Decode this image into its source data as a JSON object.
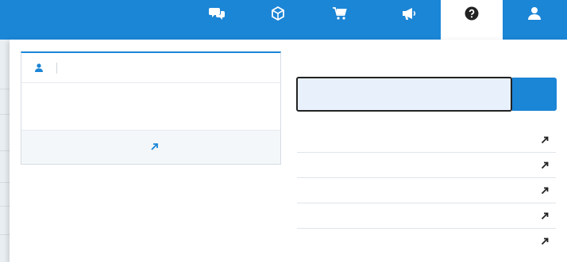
{
  "header": {
    "user_code": "",
    "nav": [
      {
        "label": "",
        "icon": "chat-bubbles-icon"
      },
      {
        "label": "",
        "icon": "box-icon"
      },
      {
        "label": "",
        "icon": "cart-icon"
      },
      {
        "label": "",
        "icon": "megaphone-icon"
      },
      {
        "label": "",
        "icon": "question-circle-icon"
      },
      {
        "label": "",
        "icon": "user-icon"
      }
    ],
    "active_index": 4
  },
  "contact_card": {
    "title": "",
    "email": "",
    "form_link": ""
  },
  "search": {
    "title": "",
    "input_value": "",
    "button_label": ""
  },
  "links": [
    {
      "label": ""
    },
    {
      "label": ""
    },
    {
      "label": ""
    },
    {
      "label": ""
    },
    {
      "label": ""
    }
  ],
  "colors": {
    "accent": "#1b85d6",
    "active_nav_bg": "#ffffff",
    "muted_user_code": "#8fc4ef"
  }
}
